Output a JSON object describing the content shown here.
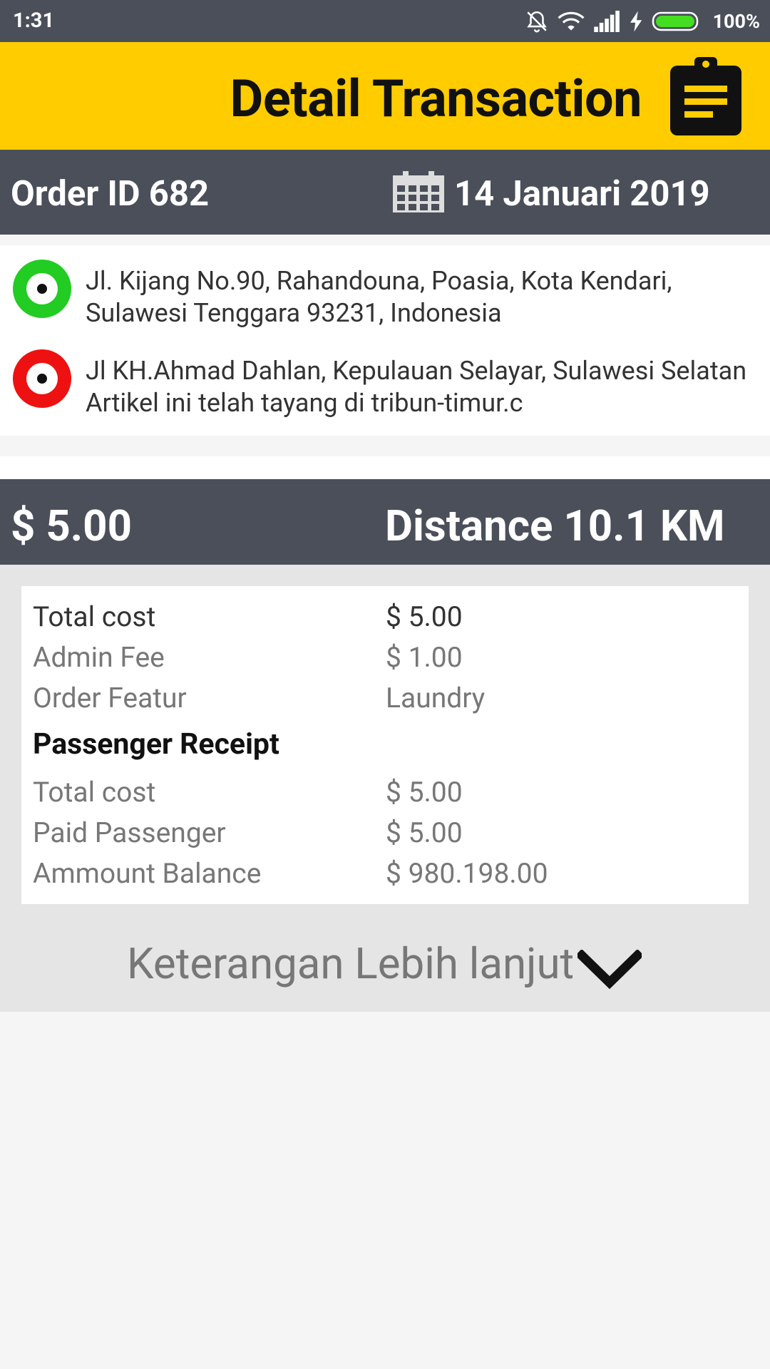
{
  "status_bar": {
    "time": "1:31",
    "battery": "100%"
  },
  "app_bar": {
    "title": "Detail Transaction",
    "icon": "clipboard-icon"
  },
  "order": {
    "id_label": "Order ID 682",
    "date": "14 Januari 2019",
    "date_icon": "calendar-icon"
  },
  "route": {
    "pickup": "Jl. Kijang No.90, Rahandouna, Poasia, Kota Kendari, Sulawesi Tenggara 93231, Indonesia",
    "destination": "Jl KH.Ahmad Dahlan, Kepulauan Selayar, Sulawesi Selatan   Artikel ini telah tayang di tribun-timur.c",
    "pickup_color": "#22cc22",
    "destination_color": "#ee1111"
  },
  "summary": {
    "price": "$ 5.00",
    "distance": "Distance 10.1 KM"
  },
  "details": {
    "total_cost_label": "Total cost",
    "total_cost_value": "$ 5.00",
    "admin_fee_label": "Admin Fee",
    "admin_fee_value": "$ 1.00",
    "order_featur_label": "Order Featur",
    "order_featur_value": "Laundry",
    "receipt_title": "Passenger Receipt",
    "receipt_total_label": "Total cost",
    "receipt_total_value": "$ 5.00",
    "paid_label": "Paid Passenger",
    "paid_value": "$ 5.00",
    "balance_label": "Ammount Balance",
    "balance_value": "$ 980.198.00"
  },
  "more": {
    "label": "Keterangan Lebih lanjut",
    "icon": "chevron-down-icon"
  },
  "colors": {
    "accent": "#ffcc00",
    "header_dark": "#4a4f5a"
  }
}
